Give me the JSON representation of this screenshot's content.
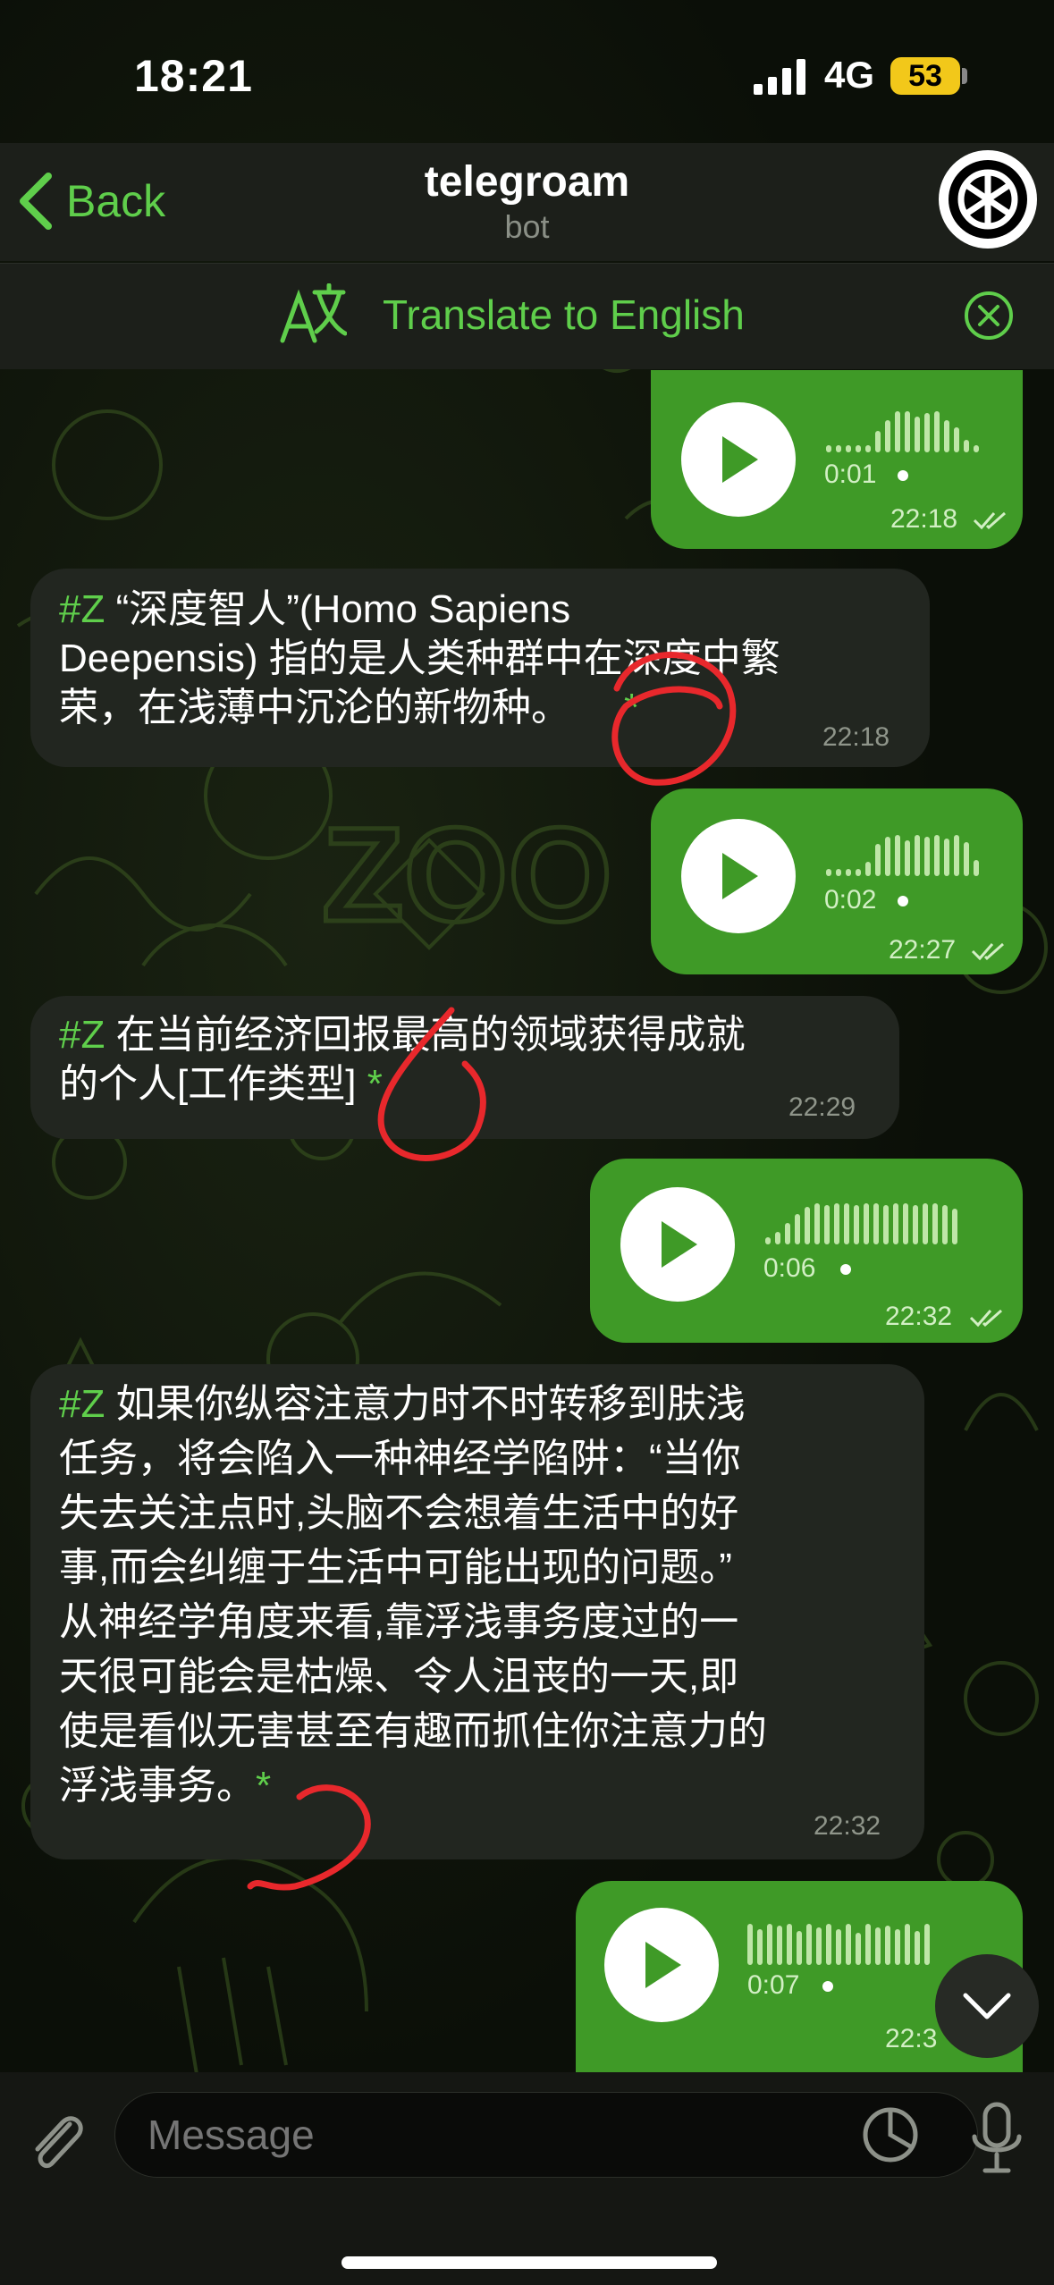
{
  "status_bar": {
    "time": "18:21",
    "network": "4G",
    "battery": "53"
  },
  "header": {
    "back_label": "Back",
    "title": "telegroam",
    "subtitle": "bot"
  },
  "translate_bar": {
    "label": "Translate to English"
  },
  "messages": [
    {
      "type": "voice",
      "direction": "out",
      "duration": "0:01",
      "time": "22:18"
    },
    {
      "type": "text",
      "direction": "in",
      "hashtag": "#Z",
      "lines": [
        "“深度智人”(Homo Sapiens",
        "Deepensis) 指的是人类种群中在深度中繁",
        "荣，在浅薄中沉沦的新物种。"
      ],
      "star": "*",
      "time": "22:18"
    },
    {
      "type": "voice",
      "direction": "out",
      "duration": "0:02",
      "time": "22:27"
    },
    {
      "type": "text",
      "direction": "in",
      "hashtag": "#Z",
      "lines": [
        "在当前经济回报最高的领域获得成就",
        "的个人[工作类型]"
      ],
      "star": "*",
      "time": "22:29"
    },
    {
      "type": "voice",
      "direction": "out",
      "duration": "0:06",
      "time": "22:32"
    },
    {
      "type": "text",
      "direction": "in",
      "hashtag": "#Z",
      "lines": [
        "如果你纵容注意力时不时转移到肤浅",
        "任务，将会陷入一种神经学陷阱：“当你",
        "失去关注点时,头脑不会想着生活中的好",
        "事,而会纠缠于生活中可能出现的问题。”",
        "从神经学角度来看,靠浮浅事务度过的一",
        "天很可能会是枯燥、令人沮丧的一天,即",
        "使是看似无害甚至有趣而抓住你注意力的",
        "浮浅事务。"
      ],
      "star": "*",
      "time": "22:32"
    },
    {
      "type": "voice",
      "direction": "out",
      "duration": "0:07",
      "time": "22:3"
    }
  ],
  "input": {
    "placeholder": "Message"
  },
  "icons": {
    "back": "chevron-left-icon",
    "translate": "translate-icon",
    "close": "close-circle-icon",
    "play": "play-icon",
    "read": "double-check-icon",
    "scroll": "chevron-down-icon",
    "attach": "paperclip-icon",
    "sticker": "sticker-icon",
    "mic": "microphone-icon"
  },
  "colors": {
    "accent": "#5fce4b",
    "outgoing_bubble": "#3f9a27",
    "incoming_bubble": "#222620",
    "annotation": "#e8282c",
    "battery": "#f2c81a"
  }
}
